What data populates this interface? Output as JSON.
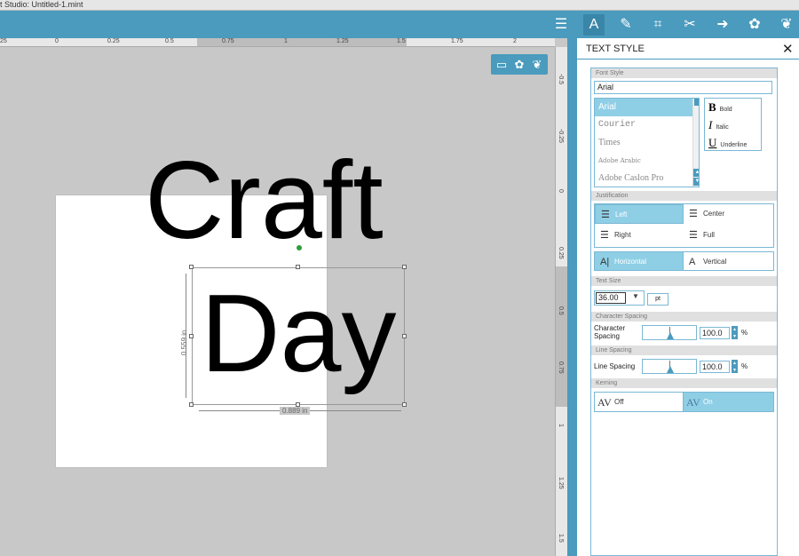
{
  "window": {
    "title": "t Studio: Untitled-1.mint"
  },
  "toolbar": {
    "icons": [
      "page-setup-icon",
      "text-style-icon",
      "line-style-icon",
      "crop-icon",
      "trace-icon",
      "send-icon",
      "fill-icon",
      "design-store-icon"
    ]
  },
  "ruler": {
    "top_labels": [
      "25",
      "0",
      "0.25",
      "0.5",
      "0.75",
      "1",
      "1.25",
      "1.5",
      "1.75",
      "2"
    ],
    "right_labels": [
      "-0.5",
      "-0.25",
      "0",
      "0.25",
      "0.5",
      "0.75",
      "1",
      "1.25",
      "1.5"
    ]
  },
  "canvas": {
    "line1": "Craft",
    "line2": "Day",
    "height_label": "0.559 in",
    "width_label": "0.889 in"
  },
  "panel": {
    "title": "TEXT STYLE",
    "close": "✕",
    "sections": {
      "font_style": "Font Style",
      "justification": "Justification",
      "text_size": "Text Size",
      "char_spacing": "Character Spacing",
      "line_spacing": "Line Spacing",
      "kerning": "Kerning"
    },
    "font_field": "Arial",
    "font_list": [
      "Arial",
      "Courier",
      "Times",
      "Adobe Arabic",
      "Adobe Caslon Pro"
    ],
    "styles": {
      "bold": "Bold",
      "italic": "Italic",
      "underline": "Underline"
    },
    "justify": {
      "left": "Left",
      "center": "Center",
      "right": "Right",
      "full": "Full",
      "horizontal": "Horizontal",
      "vertical": "Vertical"
    },
    "text_size": {
      "value": "36.00",
      "unit": "pt"
    },
    "character_spacing": {
      "label": "Character Spacing",
      "value": "100.0",
      "unit": "%"
    },
    "line_spacing": {
      "label": "Line Spacing",
      "value": "100.0",
      "unit": "%"
    },
    "kerning": {
      "off": "Off",
      "on": "On"
    }
  },
  "colors": {
    "accent": "#4a9bbd",
    "selected": "#8fcfe6"
  }
}
